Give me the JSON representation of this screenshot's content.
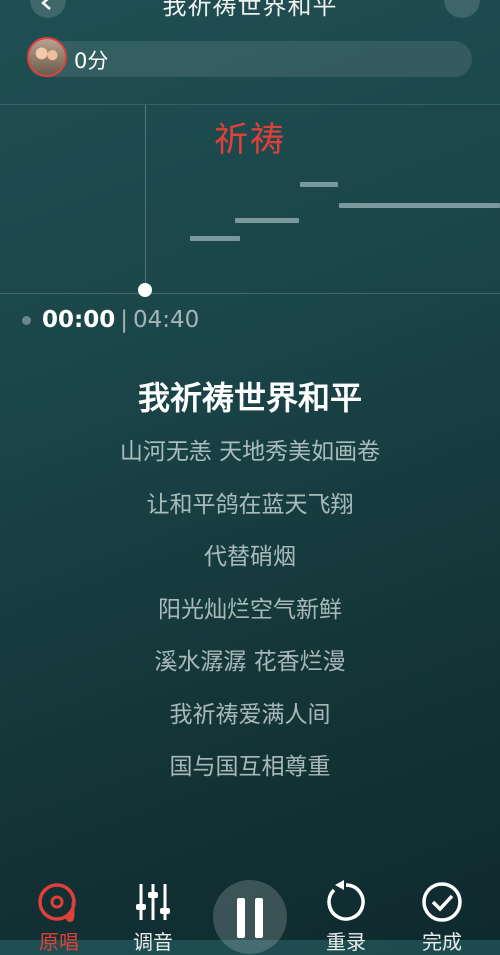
{
  "header": {
    "title": "我祈祷世界和平"
  },
  "score": {
    "text": "0分"
  },
  "pitch": {
    "current_word": "祈祷"
  },
  "time": {
    "current": "00:00",
    "separator": "|",
    "total": "04:40"
  },
  "lyrics": {
    "current": "我祈祷世界和平",
    "lines": [
      "山河无恙 天地秀美如画卷",
      "让和平鸽在蓝天飞翔",
      "代替硝烟",
      "阳光灿烂空气新鲜",
      "溪水潺潺 花香烂漫",
      "我祈祷爱满人间",
      "国与国互相尊重"
    ]
  },
  "controls": {
    "original": "原唱",
    "tune": "调音",
    "rerecord": "重录",
    "finish": "完成",
    "active_color": "#e0403a"
  }
}
